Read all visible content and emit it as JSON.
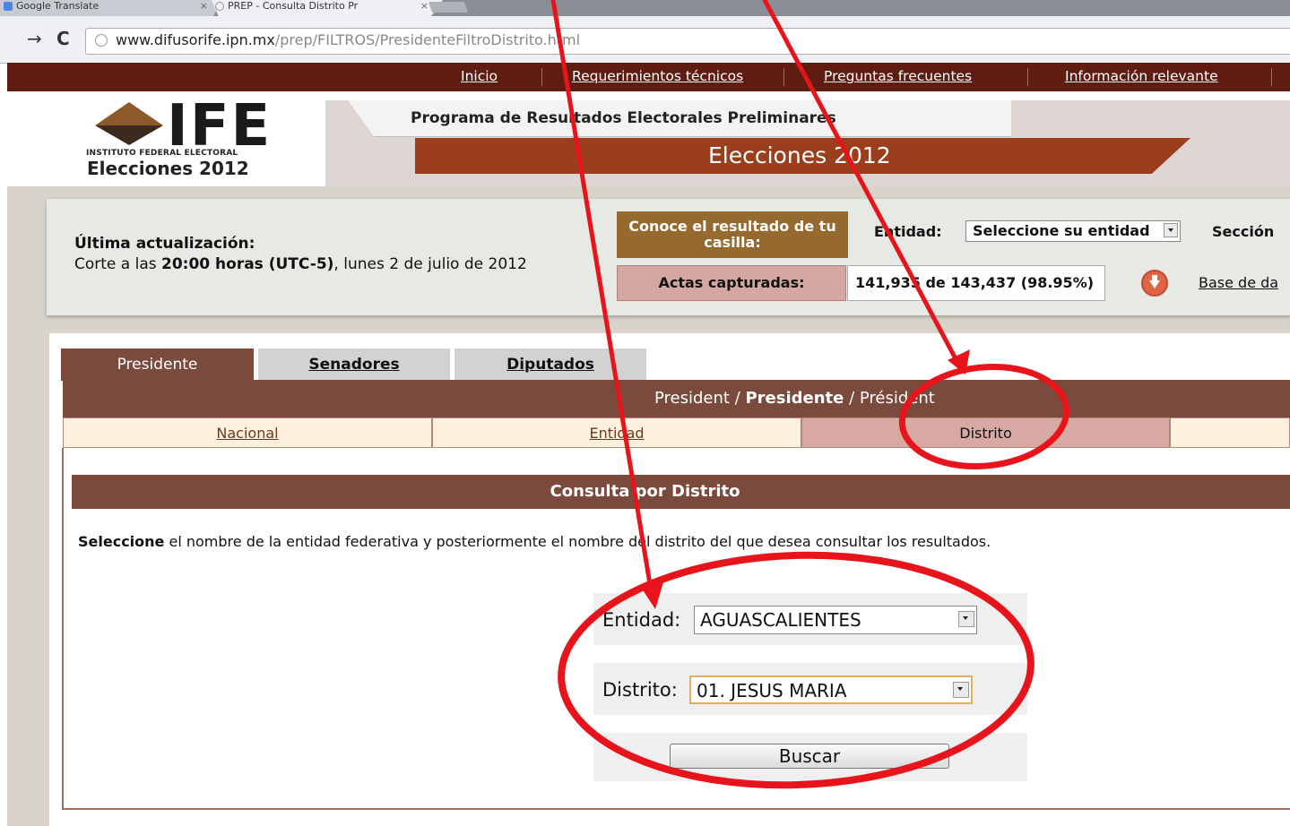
{
  "browser": {
    "tabs": [
      {
        "title": "Google Translate"
      },
      {
        "title": "PREP - Consulta Distrito Pr"
      }
    ],
    "url_host": "www.difusorife.ipn.mx",
    "url_path": "/prep/FILTROS/PresidenteFiltroDistrito.html"
  },
  "topnav": [
    "Inicio",
    "Requerimientos técnicos",
    "Preguntas frecuentes",
    "Información relevante"
  ],
  "header": {
    "logo_text": "IFE",
    "logo_institute": "INSTITUTO FEDERAL ELECTORAL",
    "logo_elecciones": "Elecciones 2012",
    "program": "Programa de Resultados Electorales Preliminares",
    "elecciones": "Elecciones 2012"
  },
  "info": {
    "ultima_label": "Última actualización:",
    "corte_prefix": "Corte a las ",
    "corte_time": "20:00 horas (UTC-5)",
    "corte_suffix": ", lunes 2 de julio de 2012",
    "conoce": "Conoce el resultado de tu casilla:",
    "entidad_label": "Entidad:",
    "entidad_select": "Seleccione su entidad",
    "seccion_label": "Sección",
    "actas_label": "Actas capturadas:",
    "actas_value": "141,935 de 143,437 (98.95%)",
    "base_link": "Base de da"
  },
  "tabs": [
    "Presidente",
    "Senadores",
    "Diputados"
  ],
  "pres_title": {
    "a": "President / ",
    "b": "Presidente",
    "c": " / Président"
  },
  "subtabs": [
    "Nacional",
    "Entidad",
    "Distrito"
  ],
  "consulta": {
    "title": "Consulta por Distrito",
    "instr_bold": "Seleccione",
    "instr_rest": " el nombre de la entidad federativa y posteriormente el nombre del distrito del que desea consultar los resultados.",
    "entidad_label": "Entidad:",
    "entidad_value": "AGUASCALIENTES",
    "distrito_label": "Distrito:",
    "distrito_value": "01. JESUS MARIA",
    "buscar": "Buscar"
  },
  "colors": {
    "brand_brown": "#7a4a3c",
    "annotation_red": "#e8141c"
  }
}
